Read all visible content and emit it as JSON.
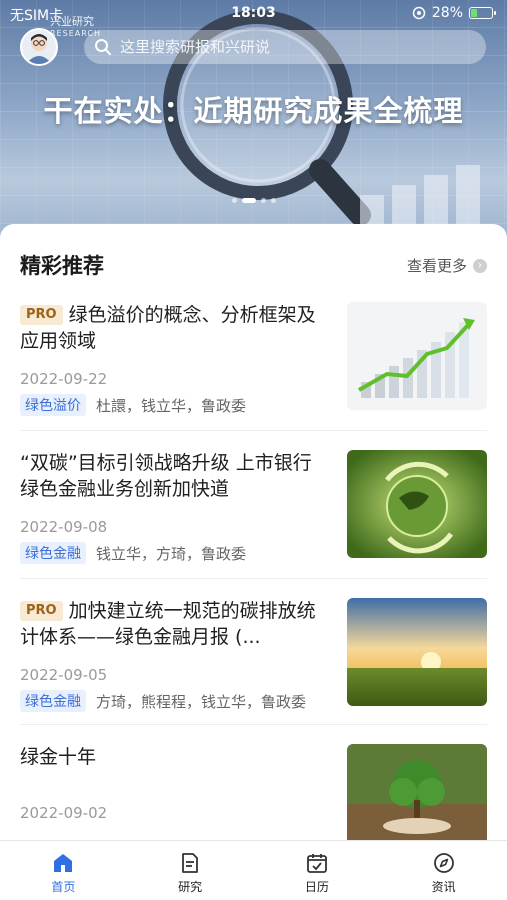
{
  "status_bar": {
    "carrier": "无SIM卡",
    "time": "18:03",
    "battery": "28%",
    "battery_level": 0.28
  },
  "brand": {
    "name": "兴业研究",
    "sub": "RESEARCH"
  },
  "search": {
    "placeholder": "这里搜索研报和兴研说"
  },
  "banner": {
    "headline": "干在实处：近期研究成果全梳理",
    "slide_count": 4,
    "active_slide": 2
  },
  "section": {
    "title": "精彩推荐",
    "more": "查看更多"
  },
  "articles": [
    {
      "pro": "PRO",
      "title": "绿色溢价的概念、分析框架及应用领域",
      "date": "2022-09-22",
      "tag": "绿色溢价",
      "authors": "杜譞，钱立华，鲁政委",
      "thumb_icon": "rising-chart-image"
    },
    {
      "pro": "",
      "title": "“双碳”目标引领战略升级 上市银行绿色金融业务创新加快道",
      "date": "2022-09-08",
      "tag": "绿色金融",
      "authors": "钱立华，方琦，鲁政委",
      "thumb_icon": "green-globe-image"
    },
    {
      "pro": "PRO",
      "title": "加快建立统一规范的碳排放统计体系——绿色金融月报 (...",
      "date": "2022-09-05",
      "tag": "绿色金融",
      "authors": "方琦，熊程程，钱立华，鲁政委",
      "thumb_icon": "sunrise-field-image"
    },
    {
      "pro": "",
      "title": "绿金十年",
      "date": "2022-09-02",
      "tag": "",
      "authors": "",
      "thumb_icon": "tree-on-hand-image"
    }
  ],
  "tabs": [
    {
      "label": "首页",
      "icon": "home-icon",
      "active": true
    },
    {
      "label": "研究",
      "icon": "document-icon",
      "active": false
    },
    {
      "label": "日历",
      "icon": "calendar-icon",
      "active": false
    },
    {
      "label": "资讯",
      "icon": "compass-icon",
      "active": false
    }
  ],
  "colors": {
    "accent": "#2f6fe3",
    "tag_bg": "#e8f0fd",
    "tag_text": "#3b6fd6",
    "pro_bg": "#f7e9d3",
    "pro_text": "#9a6418"
  }
}
